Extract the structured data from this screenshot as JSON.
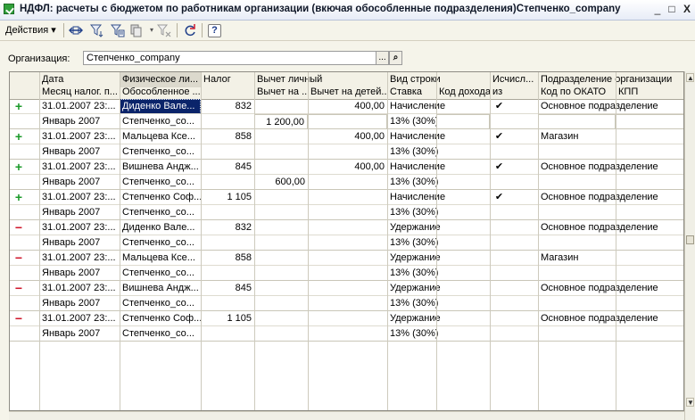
{
  "window": {
    "title": "НДФЛ: расчеты с бюджетом по работникам организации (вкючая обособленные подразделения)Степченко_company",
    "minimize": "_",
    "maximize": "□",
    "close": "X"
  },
  "toolbar": {
    "actions_label": "Действия",
    "actions_arrow": "▾",
    "icons": [
      "sync-icon",
      "filter-icon",
      "filter-list-icon",
      "copy-icon",
      "clear-filter-icon",
      "refresh-icon",
      "help-icon"
    ],
    "help_label": "?"
  },
  "organization": {
    "label": "Организация:",
    "value": "Степченко_company",
    "select_btn": "...",
    "search_btn": "⌕"
  },
  "header": {
    "row1": {
      "date": "Дата",
      "person": "Физическое ли...",
      "tax": "Налог",
      "deduction": "Вычет личный",
      "row_type": "Вид строки",
      "calc": "Исчисл...",
      "division": "Подразделение организации"
    },
    "row2": {
      "month": "Месяц налог. п...",
      "isolated": "Обособленное ...",
      "deduction_on": "Вычет на ...",
      "deduction_children": "Вычет на детей...",
      "rate": "Ставка",
      "income_code": "Код дохода",
      "calc_sub": "из",
      "okato": "Код по ОКАТО",
      "kpp": "КПП"
    }
  },
  "rows": [
    {
      "sign": "+",
      "date": "31.01.2007 23:...",
      "person": "Диденко Вале...",
      "tax": "832",
      "ded_personal": "400,00",
      "row_type": "Начисление",
      "calc": "✔",
      "division": "Основное подразделение",
      "month": "Январь 2007",
      "isolated": "Степченко_со...",
      "ded_on": "1 200,00",
      "ded_children": "",
      "rate": "13% (30%)"
    },
    {
      "sign": "+",
      "date": "31.01.2007 23:...",
      "person": "Мальцева Ксе...",
      "tax": "858",
      "ded_personal": "400,00",
      "row_type": "Начисление",
      "calc": "✔",
      "division": "Магазин",
      "month": "Январь 2007",
      "isolated": "Степченко_со...",
      "ded_on": "",
      "ded_children": "",
      "rate": "13% (30%)"
    },
    {
      "sign": "+",
      "date": "31.01.2007 23:...",
      "person": "Вишнева Андж...",
      "tax": "845",
      "ded_personal": "400,00",
      "row_type": "Начисление",
      "calc": "✔",
      "division": "Основное подразделение",
      "month": "Январь 2007",
      "isolated": "Степченко_со...",
      "ded_on": "600,00",
      "ded_children": "",
      "rate": "13% (30%)"
    },
    {
      "sign": "+",
      "date": "31.01.2007 23:...",
      "person": "Степченко Соф...",
      "tax": "1 105",
      "ded_personal": "",
      "row_type": "Начисление",
      "calc": "✔",
      "division": "Основное подразделение",
      "month": "Январь 2007",
      "isolated": "Степченко_со...",
      "ded_on": "",
      "ded_children": "",
      "rate": "13% (30%)"
    },
    {
      "sign": "−",
      "date": "31.01.2007 23:...",
      "person": "Диденко Вале...",
      "tax": "832",
      "ded_personal": "",
      "row_type": "Удержание",
      "calc": "",
      "division": "Основное подразделение",
      "month": "Январь 2007",
      "isolated": "Степченко_со...",
      "ded_on": "",
      "ded_children": "",
      "rate": "13% (30%)"
    },
    {
      "sign": "−",
      "date": "31.01.2007 23:...",
      "person": "Мальцева Ксе...",
      "tax": "858",
      "ded_personal": "",
      "row_type": "Удержание",
      "calc": "",
      "division": "Магазин",
      "month": "Январь 2007",
      "isolated": "Степченко_со...",
      "ded_on": "",
      "ded_children": "",
      "rate": "13% (30%)"
    },
    {
      "sign": "−",
      "date": "31.01.2007 23:...",
      "person": "Вишнева Андж...",
      "tax": "845",
      "ded_personal": "",
      "row_type": "Удержание",
      "calc": "",
      "division": "Основное подразделение",
      "month": "Январь 2007",
      "isolated": "Степченко_со...",
      "ded_on": "",
      "ded_children": "",
      "rate": "13% (30%)"
    },
    {
      "sign": "−",
      "date": "31.01.2007 23:...",
      "person": "Степченко Соф...",
      "tax": "1 105",
      "ded_personal": "",
      "row_type": "Удержание",
      "calc": "",
      "division": "Основное подразделение",
      "month": "Январь 2007",
      "isolated": "Степченко_со...",
      "ded_on": "",
      "ded_children": "",
      "rate": "13% (30%)"
    }
  ],
  "scrollbar": {
    "up": "▲",
    "down": "▼"
  },
  "colors": {
    "plus": "#1b9a2a",
    "minus": "#d0162a",
    "selection": "#0a246a"
  }
}
